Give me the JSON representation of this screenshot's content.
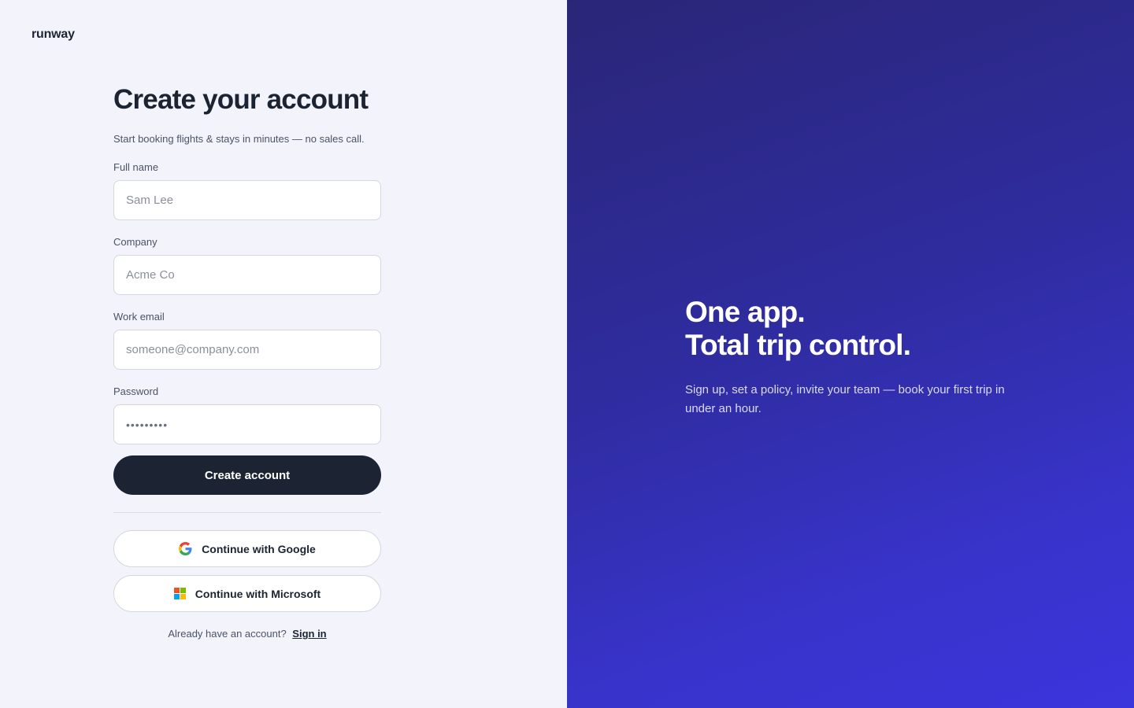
{
  "brand": {
    "logo_text": "runway"
  },
  "form": {
    "title": "Create your account",
    "subtitle": "Start booking flights & stays in minutes — no sales call.",
    "fields": [
      {
        "label": "Full name",
        "placeholder": "Sam Lee",
        "value": ""
      },
      {
        "label": "Company",
        "placeholder": "Acme Co",
        "value": ""
      },
      {
        "label": "Work email",
        "placeholder": "someone@company.com",
        "value": ""
      },
      {
        "label": "Password",
        "placeholder": "",
        "value": "•••••••••"
      }
    ],
    "submit_label": "Create account",
    "google_label": "Continue with Google",
    "microsoft_label": "Continue with Microsoft",
    "signin_prompt": "Already have an account?",
    "signin_link": "Sign in"
  },
  "hero": {
    "line1": "One app.",
    "line2": "Total trip control.",
    "subtitle": "Sign up, set a policy, invite your team — book your first trip in under an hour."
  },
  "icons": {
    "google": "google-g-icon",
    "microsoft": "microsoft-logo-icon"
  },
  "colors": {
    "primary_button": "#1c2433",
    "left_background": "#f3f3fb",
    "right_gradient_start": "#2a2677",
    "right_gradient_end": "#3b35dd"
  }
}
